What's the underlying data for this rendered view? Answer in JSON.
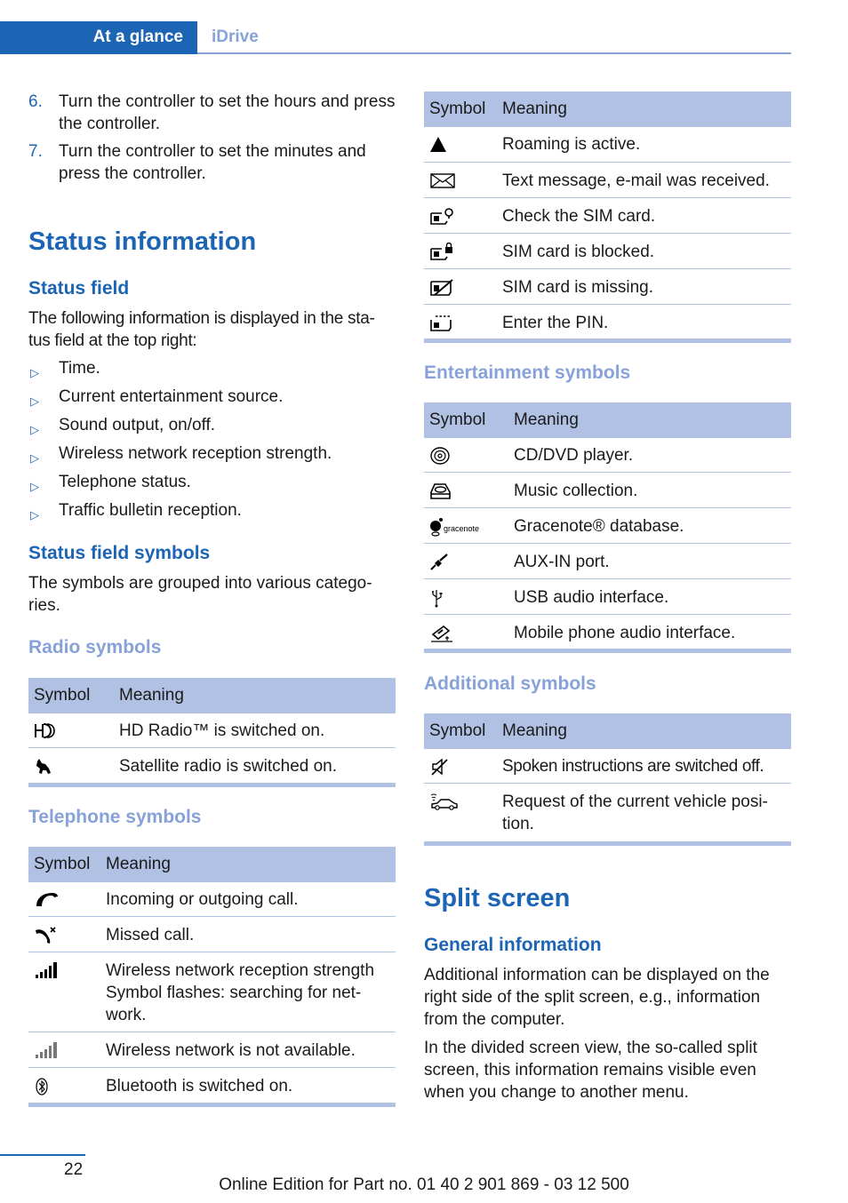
{
  "header": {
    "active_tab": "At a glance",
    "inactive_tab": "iDrive"
  },
  "steps": [
    {
      "num": "6.",
      "text": "Turn the controller to set the hours and press the controller."
    },
    {
      "num": "7.",
      "text": "Turn the controller to set the minutes and press the controller."
    }
  ],
  "status_information": {
    "title": "Status information",
    "status_field": {
      "heading": "Status field",
      "intro": "The following information is displayed in the sta-tus field at the top right:",
      "bullets": [
        "Time.",
        "Current entertainment source.",
        "Sound output, on/off.",
        "Wireless network reception strength.",
        "Telephone status.",
        "Traffic bulletin reception."
      ]
    },
    "status_field_symbols": {
      "heading": "Status field symbols",
      "intro": "The symbols are grouped into various catego-ries."
    }
  },
  "table_headers": {
    "symbol": "Symbol",
    "meaning": "Meaning"
  },
  "radio_symbols": {
    "heading": "Radio symbols",
    "rows": [
      {
        "icon": "hd-radio-icon",
        "meaning": "HD Radio™ is switched on."
      },
      {
        "icon": "satellite-radio-dog-icon",
        "meaning": "Satellite radio is switched on."
      }
    ]
  },
  "telephone_symbols": {
    "heading": "Telephone symbols",
    "rows": [
      {
        "icon": "phone-handset-icon",
        "meaning": "Incoming or outgoing call."
      },
      {
        "icon": "missed-call-icon",
        "meaning": "Missed call."
      },
      {
        "icon": "signal-strength-icon",
        "meaning": "Wireless network reception strength Symbol flashes: searching for net-work."
      },
      {
        "icon": "signal-unavailable-icon",
        "meaning": "Wireless network is not available."
      },
      {
        "icon": "bluetooth-icon",
        "meaning": "Bluetooth is switched on."
      }
    ]
  },
  "telephone_symbols_continued": {
    "rows": [
      {
        "icon": "roaming-triangle-icon",
        "meaning": "Roaming is active."
      },
      {
        "icon": "envelope-icon",
        "meaning": "Text message, e-mail was received."
      },
      {
        "icon": "sim-check-icon",
        "meaning": "Check the SIM card."
      },
      {
        "icon": "sim-locked-icon",
        "meaning": "SIM card is blocked."
      },
      {
        "icon": "sim-missing-icon",
        "meaning": "SIM card is missing."
      },
      {
        "icon": "sim-pin-icon",
        "meaning": "Enter the PIN."
      }
    ]
  },
  "entertainment_symbols": {
    "heading": "Entertainment symbols",
    "rows": [
      {
        "icon": "cd-dvd-icon",
        "meaning": "CD/DVD player."
      },
      {
        "icon": "music-collection-icon",
        "meaning": "Music collection."
      },
      {
        "icon": "gracenote-icon",
        "icon_text": "gracenote",
        "meaning": "Gracenote® database."
      },
      {
        "icon": "aux-in-plug-icon",
        "meaning": "AUX-IN port."
      },
      {
        "icon": "usb-icon",
        "meaning": "USB audio interface."
      },
      {
        "icon": "mobile-phone-audio-icon",
        "meaning": "Mobile phone audio interface."
      }
    ]
  },
  "additional_symbols": {
    "heading": "Additional symbols",
    "rows": [
      {
        "icon": "speaker-muted-icon",
        "meaning": "Spoken instructions are switched off."
      },
      {
        "icon": "vehicle-position-request-icon",
        "meaning": "Request of the current vehicle posi-tion."
      }
    ]
  },
  "split_screen": {
    "title": "Split screen",
    "general_heading": "General information",
    "paragraphs": [
      "Additional information can be displayed on the right side of the split screen, e.g., information from the computer.",
      "In the divided screen view, the so-called split screen, this information remains visible even when you change to another menu."
    ]
  },
  "footer": {
    "page_number": "22",
    "edition": "Online Edition for Part no. 01 40 2 901 869 - 03 12 500"
  },
  "colors": {
    "accent_blue": "#1c64b4",
    "light_blue": "#86a2d8",
    "table_header": "#b0c1e4"
  }
}
